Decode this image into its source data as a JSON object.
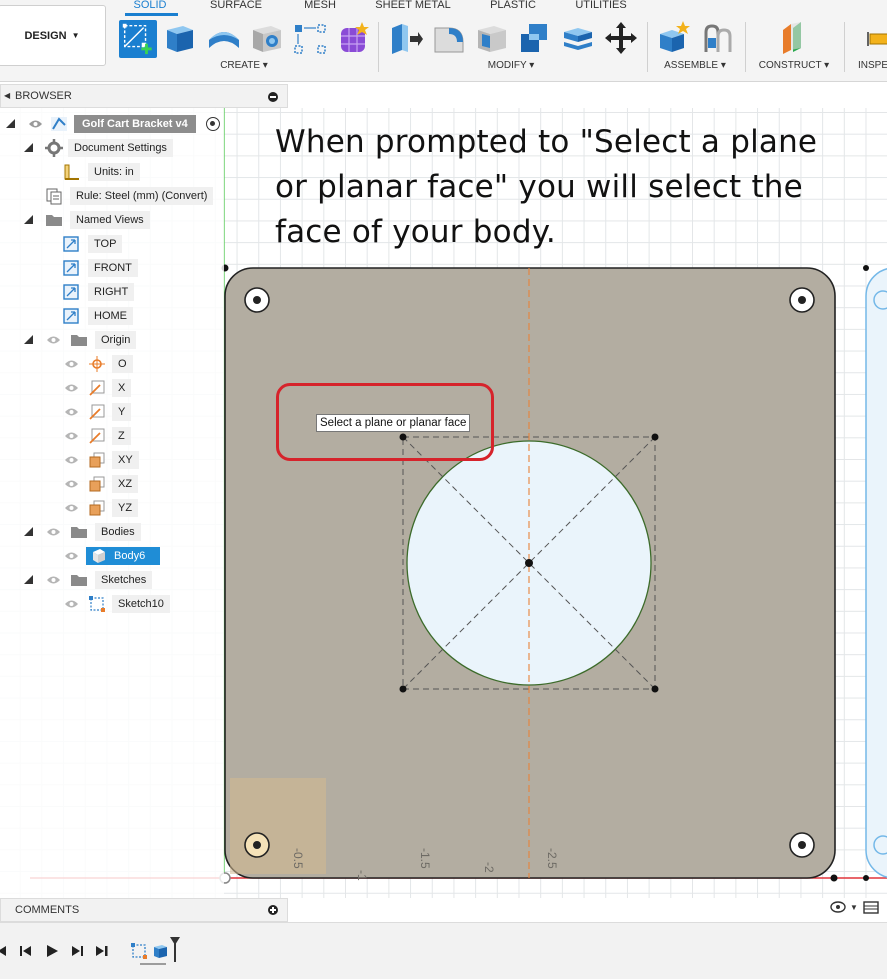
{
  "toolbar": {
    "design_label": "DESIGN",
    "tabs": [
      {
        "label": "SOLID",
        "active": true
      },
      {
        "label": "SURFACE"
      },
      {
        "label": "MESH"
      },
      {
        "label": "SHEET METAL"
      },
      {
        "label": "PLASTIC"
      },
      {
        "label": "UTILITIES"
      }
    ],
    "groups": [
      {
        "label": "CREATE ▾"
      },
      {
        "label": "MODIFY ▾"
      },
      {
        "label": "ASSEMBLE ▾"
      },
      {
        "label": "CONSTRUCT ▾"
      },
      {
        "label": "INSPE"
      }
    ],
    "accent_color": "#1a7fd0"
  },
  "browser": {
    "title": "BROWSER",
    "root": "Golf Cart Bracket v4",
    "document_settings": "Document Settings",
    "units": "Units: in",
    "rule": "Rule: Steel (mm) (Convert)",
    "named_views": "Named Views",
    "views": [
      "TOP",
      "FRONT",
      "RIGHT",
      "HOME"
    ],
    "origin": "Origin",
    "origin_items": [
      "O",
      "X",
      "Y",
      "Z",
      "XY",
      "XZ",
      "YZ"
    ],
    "bodies": "Bodies",
    "body": "Body6",
    "sketches": "Sketches",
    "sketch": "Sketch10"
  },
  "canvas": {
    "instruction": "When prompted to \"Select a plane or planar face\" you will select the face of your body.",
    "tooltip": "Select a plane or planar face",
    "callout_color": "#d6232b",
    "body_color": "#b3ada1",
    "ruler_labels": [
      "-0.5",
      "-1",
      "-1.5",
      "-2",
      "-2.5"
    ]
  },
  "comments": {
    "title": "COMMENTS"
  }
}
